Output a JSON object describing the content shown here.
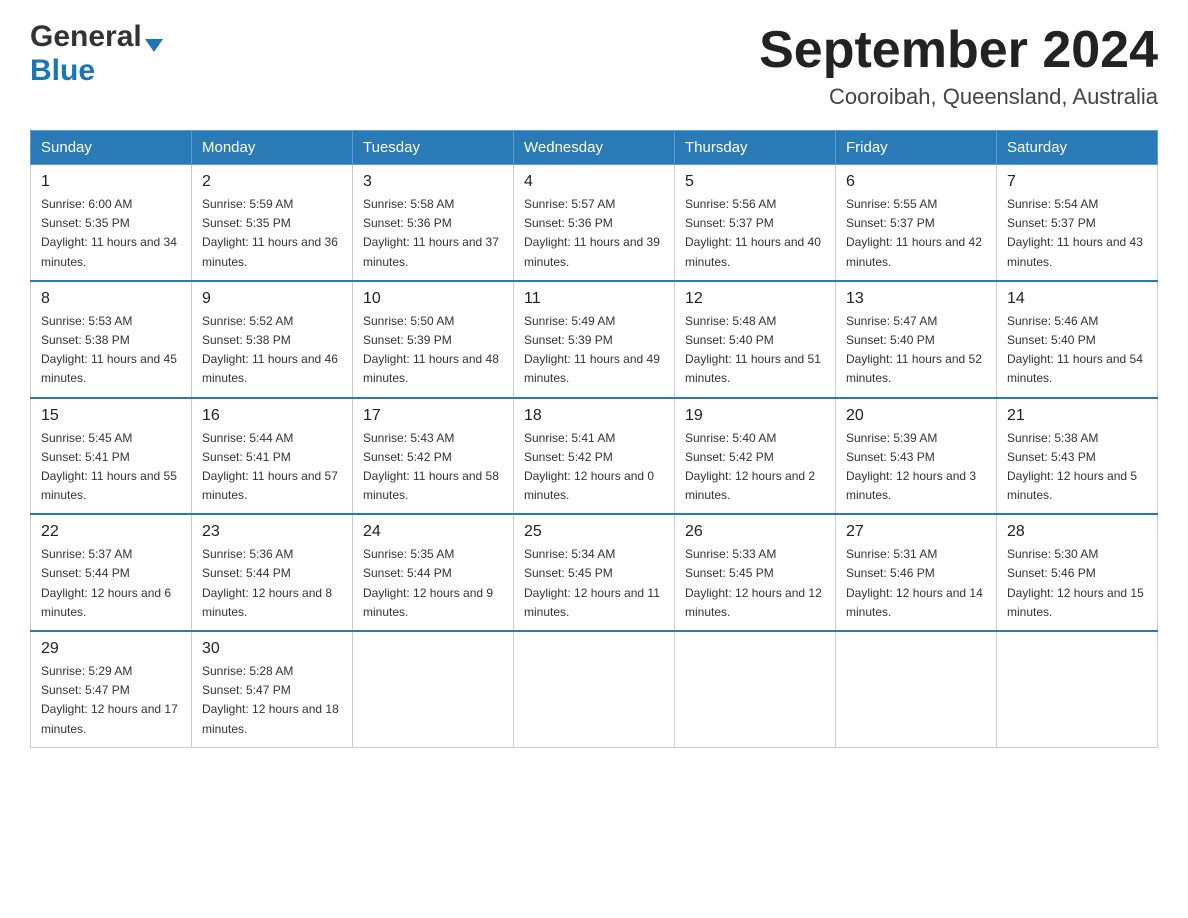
{
  "header": {
    "logo_general": "General",
    "logo_blue": "Blue",
    "title": "September 2024",
    "subtitle": "Cooroibah, Queensland, Australia"
  },
  "days_of_week": [
    "Sunday",
    "Monday",
    "Tuesday",
    "Wednesday",
    "Thursday",
    "Friday",
    "Saturday"
  ],
  "weeks": [
    [
      {
        "day": "1",
        "sunrise": "6:00 AM",
        "sunset": "5:35 PM",
        "daylight": "11 hours and 34 minutes."
      },
      {
        "day": "2",
        "sunrise": "5:59 AM",
        "sunset": "5:35 PM",
        "daylight": "11 hours and 36 minutes."
      },
      {
        "day": "3",
        "sunrise": "5:58 AM",
        "sunset": "5:36 PM",
        "daylight": "11 hours and 37 minutes."
      },
      {
        "day": "4",
        "sunrise": "5:57 AM",
        "sunset": "5:36 PM",
        "daylight": "11 hours and 39 minutes."
      },
      {
        "day": "5",
        "sunrise": "5:56 AM",
        "sunset": "5:37 PM",
        "daylight": "11 hours and 40 minutes."
      },
      {
        "day": "6",
        "sunrise": "5:55 AM",
        "sunset": "5:37 PM",
        "daylight": "11 hours and 42 minutes."
      },
      {
        "day": "7",
        "sunrise": "5:54 AM",
        "sunset": "5:37 PM",
        "daylight": "11 hours and 43 minutes."
      }
    ],
    [
      {
        "day": "8",
        "sunrise": "5:53 AM",
        "sunset": "5:38 PM",
        "daylight": "11 hours and 45 minutes."
      },
      {
        "day": "9",
        "sunrise": "5:52 AM",
        "sunset": "5:38 PM",
        "daylight": "11 hours and 46 minutes."
      },
      {
        "day": "10",
        "sunrise": "5:50 AM",
        "sunset": "5:39 PM",
        "daylight": "11 hours and 48 minutes."
      },
      {
        "day": "11",
        "sunrise": "5:49 AM",
        "sunset": "5:39 PM",
        "daylight": "11 hours and 49 minutes."
      },
      {
        "day": "12",
        "sunrise": "5:48 AM",
        "sunset": "5:40 PM",
        "daylight": "11 hours and 51 minutes."
      },
      {
        "day": "13",
        "sunrise": "5:47 AM",
        "sunset": "5:40 PM",
        "daylight": "11 hours and 52 minutes."
      },
      {
        "day": "14",
        "sunrise": "5:46 AM",
        "sunset": "5:40 PM",
        "daylight": "11 hours and 54 minutes."
      }
    ],
    [
      {
        "day": "15",
        "sunrise": "5:45 AM",
        "sunset": "5:41 PM",
        "daylight": "11 hours and 55 minutes."
      },
      {
        "day": "16",
        "sunrise": "5:44 AM",
        "sunset": "5:41 PM",
        "daylight": "11 hours and 57 minutes."
      },
      {
        "day": "17",
        "sunrise": "5:43 AM",
        "sunset": "5:42 PM",
        "daylight": "11 hours and 58 minutes."
      },
      {
        "day": "18",
        "sunrise": "5:41 AM",
        "sunset": "5:42 PM",
        "daylight": "12 hours and 0 minutes."
      },
      {
        "day": "19",
        "sunrise": "5:40 AM",
        "sunset": "5:42 PM",
        "daylight": "12 hours and 2 minutes."
      },
      {
        "day": "20",
        "sunrise": "5:39 AM",
        "sunset": "5:43 PM",
        "daylight": "12 hours and 3 minutes."
      },
      {
        "day": "21",
        "sunrise": "5:38 AM",
        "sunset": "5:43 PM",
        "daylight": "12 hours and 5 minutes."
      }
    ],
    [
      {
        "day": "22",
        "sunrise": "5:37 AM",
        "sunset": "5:44 PM",
        "daylight": "12 hours and 6 minutes."
      },
      {
        "day": "23",
        "sunrise": "5:36 AM",
        "sunset": "5:44 PM",
        "daylight": "12 hours and 8 minutes."
      },
      {
        "day": "24",
        "sunrise": "5:35 AM",
        "sunset": "5:44 PM",
        "daylight": "12 hours and 9 minutes."
      },
      {
        "day": "25",
        "sunrise": "5:34 AM",
        "sunset": "5:45 PM",
        "daylight": "12 hours and 11 minutes."
      },
      {
        "day": "26",
        "sunrise": "5:33 AM",
        "sunset": "5:45 PM",
        "daylight": "12 hours and 12 minutes."
      },
      {
        "day": "27",
        "sunrise": "5:31 AM",
        "sunset": "5:46 PM",
        "daylight": "12 hours and 14 minutes."
      },
      {
        "day": "28",
        "sunrise": "5:30 AM",
        "sunset": "5:46 PM",
        "daylight": "12 hours and 15 minutes."
      }
    ],
    [
      {
        "day": "29",
        "sunrise": "5:29 AM",
        "sunset": "5:47 PM",
        "daylight": "12 hours and 17 minutes."
      },
      {
        "day": "30",
        "sunrise": "5:28 AM",
        "sunset": "5:47 PM",
        "daylight": "12 hours and 18 minutes."
      },
      null,
      null,
      null,
      null,
      null
    ]
  ],
  "labels": {
    "sunrise": "Sunrise:",
    "sunset": "Sunset:",
    "daylight": "Daylight:"
  }
}
